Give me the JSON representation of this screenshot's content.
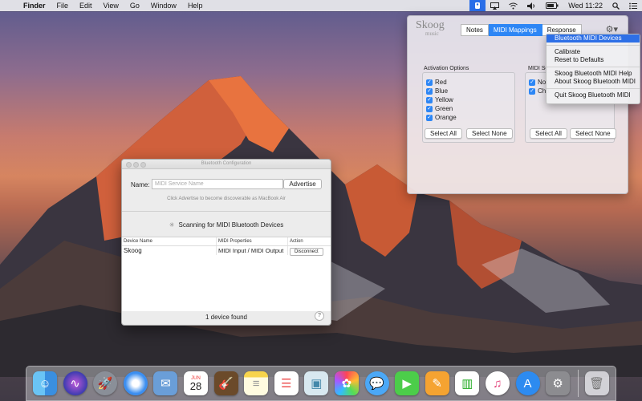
{
  "menubar": {
    "app_name": "Finder",
    "menus": [
      "File",
      "Edit",
      "View",
      "Go",
      "Window",
      "Help"
    ],
    "clock": "Wed 11:22",
    "status_icons": [
      "skoog-menu-icon",
      "airplay-icon",
      "wifi-icon",
      "volume-icon",
      "battery-icon",
      "spotlight-icon",
      "notification-center-icon"
    ]
  },
  "skoog_panel": {
    "logo": "Skoog",
    "logo_sub": "music",
    "tabs": [
      {
        "label": "Notes",
        "selected": false
      },
      {
        "label": "MIDI Mappings",
        "selected": true
      },
      {
        "label": "Response",
        "selected": false
      }
    ],
    "activation": {
      "title": "Activation Options",
      "options": [
        "Red",
        "Blue",
        "Yellow",
        "Green",
        "Orange"
      ],
      "select_all": "Select All",
      "select_none": "Select None"
    },
    "midi_section": {
      "title": "MIDI Se",
      "options": [
        "Not",
        "Cha"
      ],
      "select_all": "Select All",
      "select_none": "Select None"
    }
  },
  "dropdown_menu": {
    "items": [
      {
        "label": "Bluetooth MIDI Devices",
        "highlighted": true
      },
      {
        "label": "Calibrate"
      },
      {
        "label": "Reset to Defaults"
      },
      {
        "label": "Skoog Bluetooth MIDI Help"
      },
      {
        "label": "About Skoog Bluetooth MIDI"
      },
      {
        "label": "Quit Skoog Bluetooth MIDI"
      }
    ]
  },
  "bluetooth_window": {
    "title": "Bluetooth Configuration",
    "name_label": "Name:",
    "name_placeholder": "MIDI Service Name",
    "advertise_button": "Advertise",
    "hint": "Click Advertise to become discoverable as MacBook Air",
    "scanning_text": "Scanning for MIDI Bluetooth Devices",
    "columns": [
      "Device Name",
      "MIDI Properties",
      "Action"
    ],
    "rows": [
      {
        "device": "Skoog",
        "properties": "MIDI Input / MIDI Output",
        "action": "Disconnect"
      }
    ],
    "status": "1 device found",
    "help": "?"
  },
  "dock": {
    "apps": [
      "finder-icon",
      "siri-icon",
      "launchpad-icon",
      "safari-icon",
      "mail-icon",
      "calendar-icon",
      "garageband-icon",
      "notes-icon",
      "reminders-icon",
      "preview-icon",
      "photos-icon",
      "messages-icon",
      "facetime-icon",
      "pages-icon",
      "numbers-icon",
      "itunes-icon",
      "app-store-icon",
      "system-preferences-icon",
      "trash-icon"
    ],
    "calendar_month": "JUN",
    "calendar_day": "28"
  },
  "colors": {
    "accent": "#2d86f5",
    "menu_highlight": "#2d6fe6"
  }
}
